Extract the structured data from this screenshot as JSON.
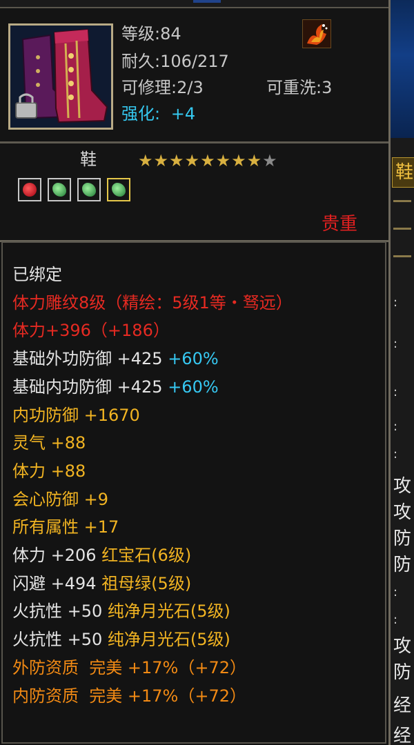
{
  "header": {
    "level_text": "等级:84",
    "durability_text": "耐久:106/217",
    "repair_text": "可修理:2/3",
    "rewash_text": "可重洗:3",
    "strength_label": "强化:",
    "strength_value": "+4"
  },
  "item": {
    "type": "鞋",
    "stars_filled": 8,
    "stars_total": 9,
    "rarity": "贵重",
    "gems": [
      "red-gem-icon",
      "green-gem-icon",
      "green-gem-icon",
      "green-gem-icon"
    ]
  },
  "attributes": [
    {
      "text": "已绑定",
      "extra": "",
      "color": "#e4e4e4"
    },
    {
      "text": "体力雕纹8级（精绘：5级1等・驽远）",
      "extra": "",
      "color": "#e62a22"
    },
    {
      "text": "体力+396（+186）",
      "extra": "",
      "color": "#e62a22"
    },
    {
      "text": "基础外功防御 +425 ",
      "extra": "+60%",
      "color": "#e4e4e4"
    },
    {
      "text": "基础内功防御 +425 ",
      "extra": "+60%",
      "color": "#e4e4e4"
    },
    {
      "text": "内功防御 +1670",
      "extra": "",
      "color": "#f2b422"
    },
    {
      "text": "灵气 +88",
      "extra": "",
      "color": "#f2b422"
    },
    {
      "text": "体力 +88",
      "extra": "",
      "color": "#f2b422"
    },
    {
      "text": "会心防御 +9",
      "extra": "",
      "color": "#f2b422"
    },
    {
      "text": "所有属性 +17",
      "extra": "",
      "color": "#f2b422"
    },
    {
      "text": "体力 +206 ",
      "extra": "红宝石(6级)",
      "color": "#e4e4e4"
    },
    {
      "text": "闪避 +494 ",
      "extra": "祖母绿(5级)",
      "color": "#e4e4e4"
    },
    {
      "text": "火抗性 +50 ",
      "extra": "纯净月光石(5级)",
      "color": "#e4e4e4"
    },
    {
      "text": "火抗性 +50 ",
      "extra": "纯净月光石(5级)",
      "color": "#e4e4e4"
    },
    {
      "text": "外防资质  完美 +17%（+72）",
      "extra": "",
      "color": "#f28a14"
    },
    {
      "text": "内防资质  完美 +17%（+72）",
      "extra": "",
      "color": "#f28a14"
    }
  ],
  "side_panel": {
    "tab_char": "鞋",
    "chars": [
      "攻",
      "攻",
      "防",
      "防",
      "攻",
      "防",
      "经",
      "经"
    ]
  },
  "colors": {
    "red": "#e62a22",
    "yellow": "#f2b422",
    "orange": "#f28a14",
    "cyan": "#36c8f2",
    "white": "#e4e4e4"
  }
}
